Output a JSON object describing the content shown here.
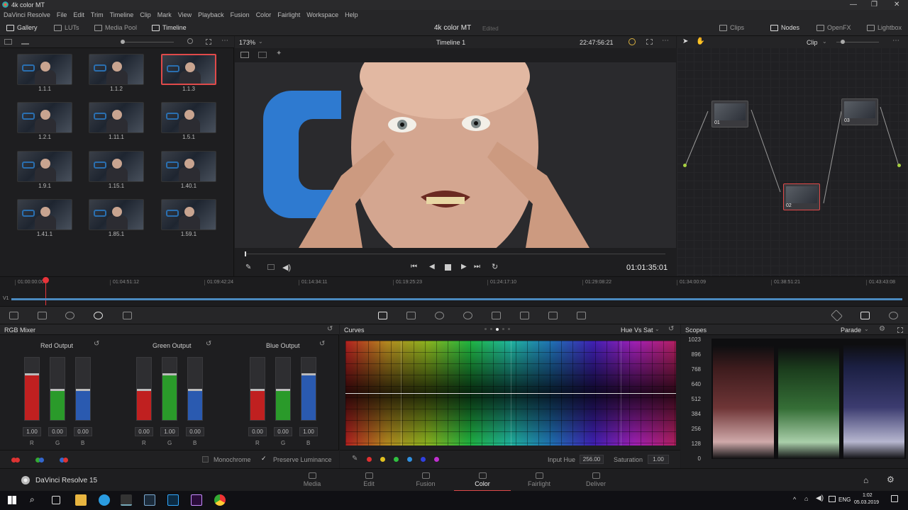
{
  "window": {
    "title": "4k color MT",
    "min": "—",
    "max": "❐",
    "close": "✕"
  },
  "menu": [
    "DaVinci Resolve",
    "File",
    "Edit",
    "Trim",
    "Timeline",
    "Clip",
    "Mark",
    "View",
    "Playback",
    "Fusion",
    "Color",
    "Fairlight",
    "Workspace",
    "Help"
  ],
  "toolbar": {
    "gallery": "Gallery",
    "luts": "LUTs",
    "media_pool": "Media Pool",
    "timeline": "Timeline",
    "project_name": "4k color MT",
    "edited": "Edited",
    "clips": "Clips",
    "nodes": "Nodes",
    "openfx": "OpenFX",
    "lightbox": "Lightbox"
  },
  "gallery": {
    "stills": [
      {
        "label": "1.1.1"
      },
      {
        "label": "1.1.2"
      },
      {
        "label": "1.1.3",
        "selected": true
      },
      {
        "label": "1.2.1"
      },
      {
        "label": "1.11.1"
      },
      {
        "label": "1.5.1"
      },
      {
        "label": "1.9.1"
      },
      {
        "label": "1.15.1"
      },
      {
        "label": "1.40.1"
      },
      {
        "label": "1.41.1"
      },
      {
        "label": "1.85.1"
      },
      {
        "label": "1.59.1"
      }
    ]
  },
  "viewer": {
    "zoom": "173%",
    "timeline_name": "Timeline 1",
    "timecode_top": "22:47:56:21",
    "timecode": "01:01:35:01"
  },
  "nodes": {
    "mode": "Clip",
    "items": [
      {
        "label": "01"
      },
      {
        "label": "02"
      },
      {
        "label": "03"
      }
    ]
  },
  "timeline": {
    "track": "V1",
    "timecodes": [
      "01:00:00:00",
      "01:04:51:12",
      "01:09:42:24",
      "01:14:34:11",
      "01:19:25:23",
      "01:24:17:10",
      "01:29:08:22",
      "01:34:00:09",
      "01:38:51:21",
      "01:43:43:08"
    ]
  },
  "rgb_mixer": {
    "title": "RGB Mixer",
    "groups": [
      {
        "title": "Red Output",
        "values": [
          "1.00",
          "0.00",
          "0.00"
        ],
        "levels": [
          0.75,
          0.5,
          0.5
        ]
      },
      {
        "title": "Green Output",
        "values": [
          "0.00",
          "1.00",
          "0.00"
        ],
        "levels": [
          0.5,
          0.75,
          0.5
        ]
      },
      {
        "title": "Blue Output",
        "values": [
          "0.00",
          "0.00",
          "1.00"
        ],
        "levels": [
          0.5,
          0.5,
          0.75
        ]
      }
    ],
    "channels": [
      "R",
      "G",
      "B"
    ],
    "monochrome": "Monochrome",
    "preserve_luminance": "Preserve Luminance",
    "preserve_checked": "✓"
  },
  "curves": {
    "title": "Curves",
    "mode": "Hue Vs Sat",
    "input_hue_label": "Input Hue",
    "input_hue": "256.00",
    "saturation_label": "Saturation",
    "saturation": "1.00",
    "swatches": [
      "#e03030",
      "#e0c020",
      "#30c040",
      "#3090e0",
      "#3040e0",
      "#c030d0"
    ]
  },
  "scopes": {
    "title": "Scopes",
    "mode": "Parade",
    "scale": [
      "1023",
      "896",
      "768",
      "640",
      "512",
      "384",
      "256",
      "128",
      "0"
    ]
  },
  "pages": [
    {
      "label": "Media"
    },
    {
      "label": "Edit"
    },
    {
      "label": "Fusion"
    },
    {
      "label": "Color",
      "active": true
    },
    {
      "label": "Fairlight"
    },
    {
      "label": "Deliver"
    }
  ],
  "app_name": "DaVinci Resolve 15",
  "taskbar": {
    "lang": "ENG",
    "time": "1:02",
    "date": "05.03.2019"
  },
  "colors": {
    "accent_red": "#e04a4a",
    "playhead": "#e8343a",
    "clip_bar": "#4a8ac0"
  }
}
